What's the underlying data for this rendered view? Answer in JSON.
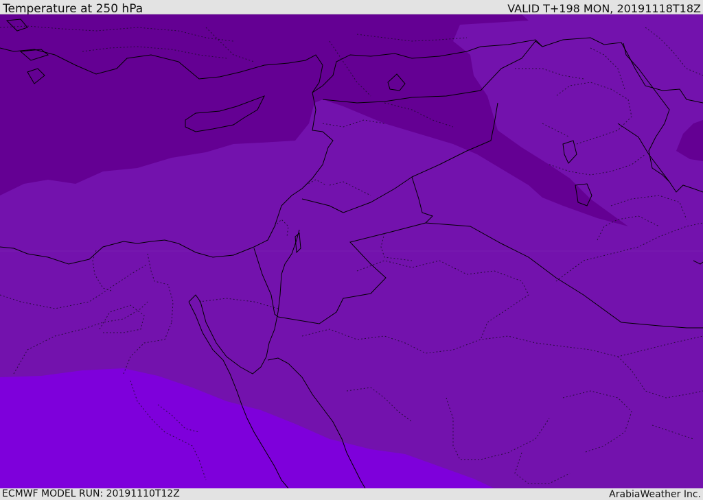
{
  "header": {
    "title": "Temperature at 250 hPa",
    "valid": "VALID T+198 MON, 20191118T18Z"
  },
  "footer": {
    "model_run": "ECMWF MODEL RUN: 20191110T12Z",
    "credit": "ArabiaWeather Inc."
  },
  "map": {
    "colors": {
      "band_north": "#640093",
      "band_mid": "#7312ad",
      "band_south": "#7e00db",
      "band_east": "#6b0aa3",
      "coastline": "#000000",
      "border_dotted": "#1a0b2a"
    }
  }
}
